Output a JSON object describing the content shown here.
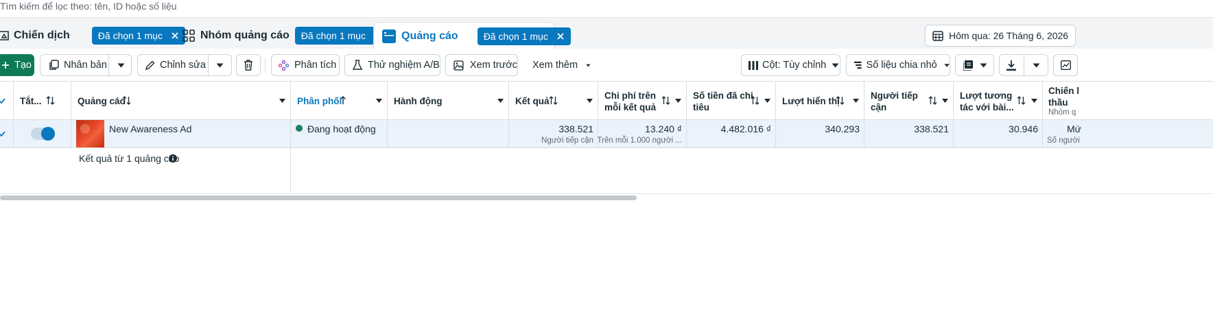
{
  "search": {
    "placeholder": "Tìm kiếm để lọc theo: tên, ID hoặc số liệu"
  },
  "tabs": {
    "campaigns": {
      "label": "Chiến dịch",
      "chip": "Đã chọn 1 mục"
    },
    "adsets": {
      "label": "Nhóm quảng cáo",
      "chip": "Đã chọn 1 mục"
    },
    "ads": {
      "label": "Quảng cáo",
      "chip": "Đã chọn 1 mục"
    },
    "date_range": "Hôm qua: 26 Tháng 6, 2026"
  },
  "toolbar": {
    "create": "Tạo",
    "duplicate": "Nhân bản",
    "edit": "Chỉnh sửa",
    "analyze": "Phân tích",
    "ab_test": "Thử nghiệm A/B",
    "preview": "Xem trước",
    "more": "Xem thêm",
    "columns": "Cột: Tùy chỉnh",
    "breakdown": "Số liệu chia nhỏ"
  },
  "colors": {
    "accent": "#0a78be",
    "create": "#0e7a57",
    "active_dot": "#1a7f64"
  },
  "table": {
    "headers": {
      "toggle": "Tắt...",
      "ad": "Quảng cáo",
      "delivery": "Phân phối",
      "actions": "Hành động",
      "results": "Kết quả",
      "cost_per_result_1": "Chi phí trên",
      "cost_per_result_2": "mỗi kết quả",
      "amount_spent_1": "Số tiền đã chi",
      "amount_spent_2": "tiêu",
      "impressions": "Lượt hiển thị",
      "reach_1": "Người tiếp",
      "reach_2": "cận",
      "engagement_1": "Lượt tương",
      "engagement_2": "tác với bài...",
      "bid_1": "Chiến l",
      "bid_2": "thầu",
      "bid_sub": "Nhóm q"
    },
    "row": {
      "ad_name": "New Awareness Ad",
      "delivery_status": "Đang hoạt động",
      "toggle_on": true,
      "results": "338.521",
      "results_sub": "Người tiếp cận",
      "cost_per_result": "13.240 ₫",
      "cost_per_result_sub": "Trên mỗi 1.000 người ...",
      "amount_spent": "4.482.016 ₫",
      "impressions": "340.293",
      "reach": "338.521",
      "engagement": "30.946",
      "bid": "Mứ",
      "bid_sub": "Số người"
    },
    "summary": "Kết quả từ 1 quảng cáo"
  }
}
